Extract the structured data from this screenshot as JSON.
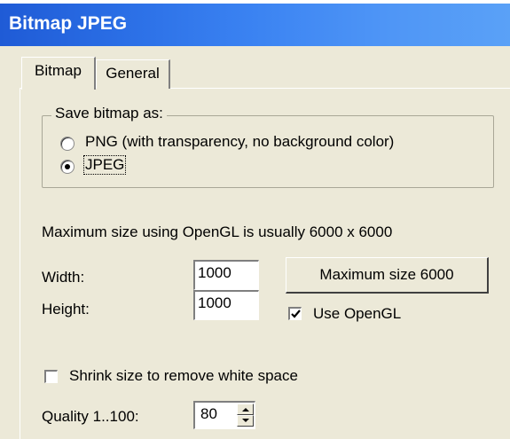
{
  "window": {
    "title": "Bitmap JPEG"
  },
  "tabs": [
    {
      "label": "Bitmap",
      "active": true
    },
    {
      "label": "General",
      "active": false
    }
  ],
  "save_group": {
    "legend": "Save bitmap as:",
    "options": [
      {
        "label": "PNG (with transparency, no background color)",
        "selected": false
      },
      {
        "label": "JPEG",
        "selected": true
      }
    ]
  },
  "info_text": "Maximum size using OpenGL is usually 6000 x 6000",
  "width": {
    "label": "Width:",
    "value": "1000"
  },
  "height": {
    "label": "Height:",
    "value": "1000"
  },
  "max_size_button": "Maximum size 6000",
  "use_opengl": {
    "label": "Use OpenGL",
    "checked": true
  },
  "shrink": {
    "label": "Shrink size to remove white space",
    "checked": false
  },
  "quality": {
    "label": "Quality 1..100:",
    "value": "80"
  },
  "colors": {
    "titlebar_start": "#1f5bd6",
    "titlebar_end": "#5aa1f7",
    "dialog_bg": "#ece9d8",
    "title_text": "#ffffff"
  }
}
